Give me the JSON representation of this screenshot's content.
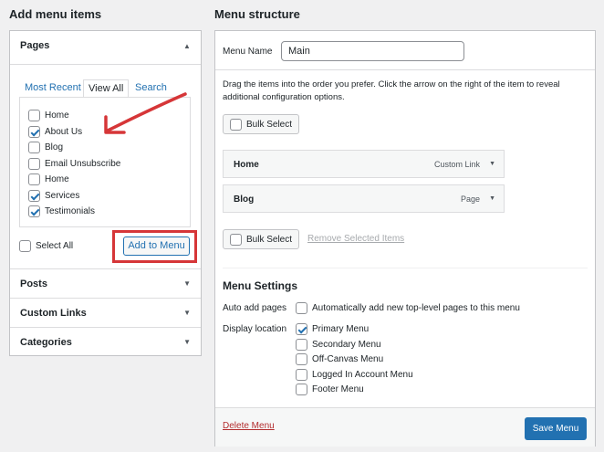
{
  "left": {
    "heading": "Add menu items",
    "pages": {
      "title": "Pages",
      "tabs": [
        "Most Recent",
        "View All",
        "Search"
      ],
      "items": [
        {
          "label": "Home",
          "checked": false
        },
        {
          "label": "About Us",
          "checked": true
        },
        {
          "label": "Blog",
          "checked": false
        },
        {
          "label": "Email Unsubscribe",
          "checked": false
        },
        {
          "label": "Home",
          "checked": false
        },
        {
          "label": "Services",
          "checked": true
        },
        {
          "label": "Testimonials",
          "checked": true
        }
      ],
      "select_all": "Select All",
      "add_button": "Add to Menu"
    },
    "sections": [
      "Posts",
      "Custom Links",
      "Categories"
    ]
  },
  "right": {
    "heading": "Menu structure",
    "menu_name_label": "Menu Name",
    "menu_name_value": "Main",
    "instructions": "Drag the items into the order you prefer. Click the arrow on the right of the item to reveal additional configuration options.",
    "bulk_select": "Bulk Select",
    "items": [
      {
        "title": "Home",
        "type": "Custom Link"
      },
      {
        "title": "Blog",
        "type": "Page"
      }
    ],
    "remove_selected": "Remove Selected Items",
    "settings": {
      "title": "Menu Settings",
      "auto_add_label": "Auto add pages",
      "auto_add_text": "Automatically add new top-level pages to this menu",
      "display_location_label": "Display location",
      "locations": [
        {
          "label": "Primary Menu",
          "checked": true
        },
        {
          "label": "Secondary Menu",
          "checked": false
        },
        {
          "label": "Off-Canvas Menu",
          "checked": false
        },
        {
          "label": "Logged In Account Menu",
          "checked": false
        },
        {
          "label": "Footer Menu",
          "checked": false
        }
      ]
    },
    "delete_menu": "Delete Menu",
    "save_menu": "Save Menu"
  },
  "colors": {
    "accent": "#2271b1",
    "highlight": "#d63638",
    "delete": "#b32d2e"
  }
}
